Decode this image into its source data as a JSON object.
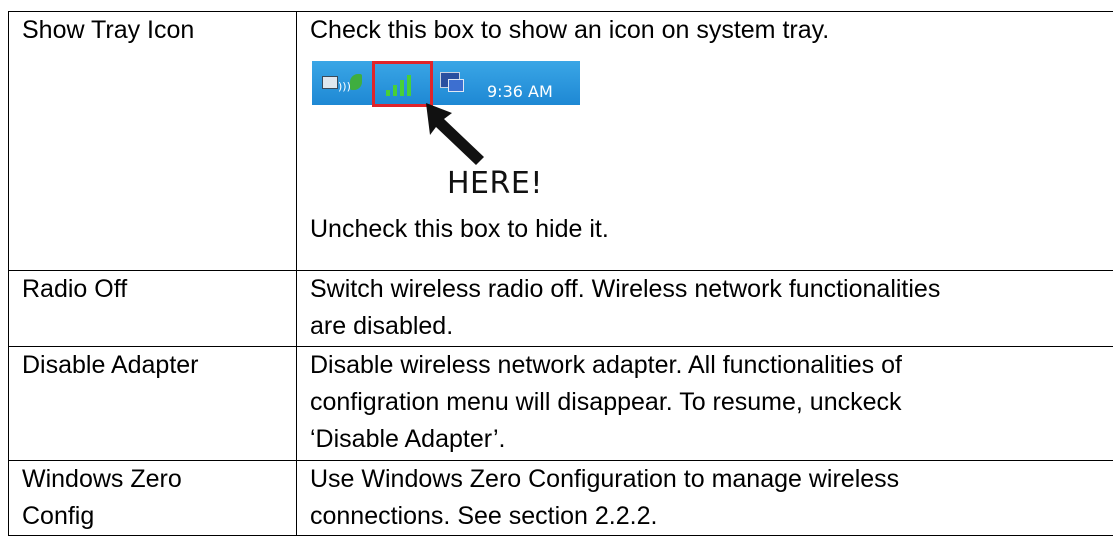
{
  "rows": [
    {
      "term": "Show Tray Icon",
      "desc_lines": [
        "Check this box to show an icon on system tray.",
        "Uncheck this box to hide it."
      ]
    },
    {
      "term": "Radio Off",
      "desc_lines": [
        "Switch wireless radio off. Wireless network functionalities",
        "are disabled."
      ]
    },
    {
      "term": "Disable Adapter",
      "desc_lines": [
        "Disable wireless network adapter. All functionalities of",
        "configration menu will disappear. To resume, unckeck",
        "‘Disable Adapter’."
      ]
    },
    {
      "term_lines": [
        "Windows Zero",
        "Config"
      ],
      "desc_lines": [
        "Use Windows Zero Configuration to manage wireless",
        "connections. See section 2.2.2."
      ]
    }
  ],
  "tray_figure": {
    "clock": "9:36 AM",
    "callout": "HERE!",
    "icons": [
      "network-icon",
      "leaf-icon",
      "signal-strength-icon",
      "computer-icon"
    ],
    "taskbar_color": "#2a96dc",
    "highlight_color": "#e0242a",
    "signal_color": "#48d038"
  }
}
